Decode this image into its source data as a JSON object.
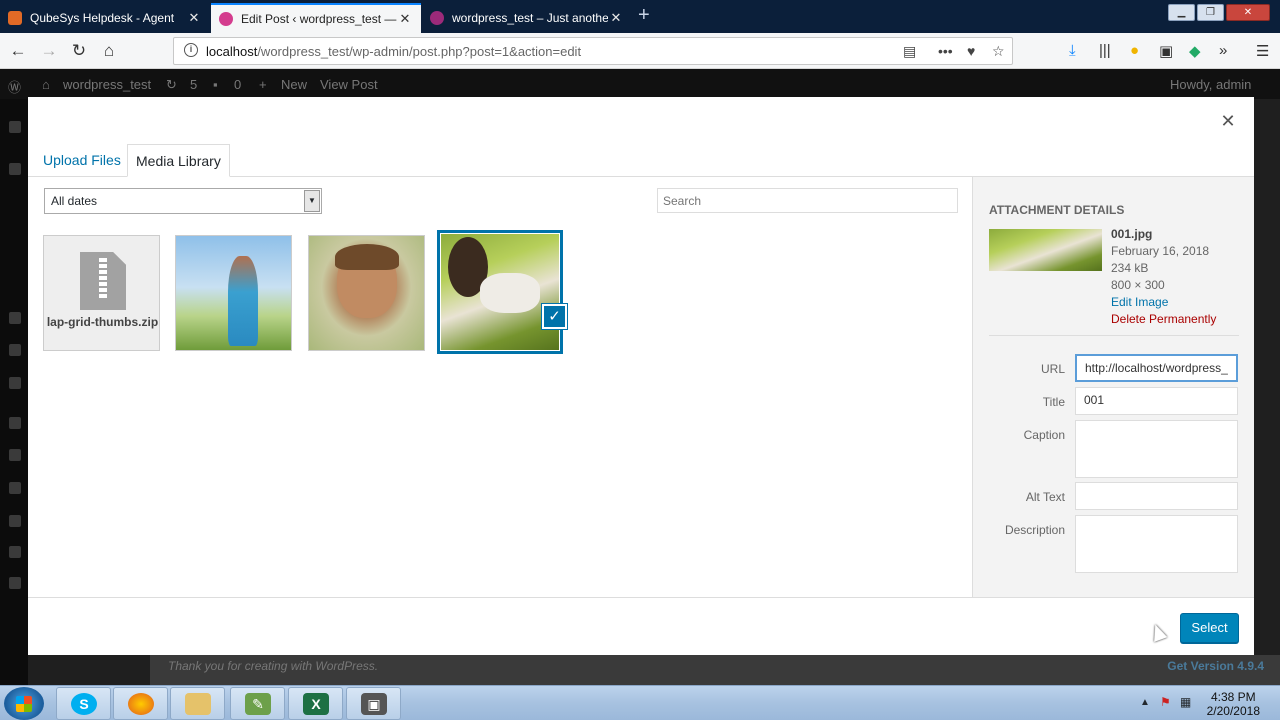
{
  "browser": {
    "tabs": [
      {
        "title": "QubeSys Helpdesk - Agent",
        "active": false
      },
      {
        "title": "Edit Post ‹ wordpress_test — W",
        "active": true
      },
      {
        "title": "wordpress_test – Just another W",
        "active": false
      }
    ],
    "url_host": "localhost",
    "url_path": "/wordpress_test/wp-admin/post.php?post=1&action=edit"
  },
  "adminbar": {
    "site_name": "wordpress_test",
    "updates": "5",
    "comments": "0",
    "new_label": "New",
    "view_post": "View Post",
    "howdy": "Howdy, admin"
  },
  "footer": {
    "thanks": "Thank you for creating with WordPress.",
    "version": "Get Version 4.9.4"
  },
  "modal": {
    "tabs": {
      "upload": "Upload Files",
      "library": "Media Library"
    },
    "date_filter": "All dates",
    "search_placeholder": "Search",
    "items": [
      {
        "type": "zip",
        "name": "lap-grid-thumbs.zip"
      },
      {
        "type": "image",
        "selected": false
      },
      {
        "type": "image",
        "selected": false
      },
      {
        "type": "image",
        "selected": true
      }
    ],
    "details": {
      "heading": "Attachment Details",
      "filename": "001.jpg",
      "date": "February 16, 2018",
      "size": "234 kB",
      "dimensions": "800 × 300",
      "edit_link": "Edit Image",
      "delete_link": "Delete Permanently",
      "labels": {
        "url": "URL",
        "title": "Title",
        "caption": "Caption",
        "alt": "Alt Text",
        "description": "Description"
      },
      "values": {
        "url": "http://localhost/wordpress_",
        "title": "001",
        "caption": "",
        "alt": "",
        "description": ""
      }
    },
    "select_button": "Select"
  },
  "taskbar": {
    "time": "4:38 PM",
    "date": "2/20/2018"
  },
  "colors": {
    "accent": "#0073aa",
    "button": "#0085ba",
    "danger": "#a00000"
  }
}
